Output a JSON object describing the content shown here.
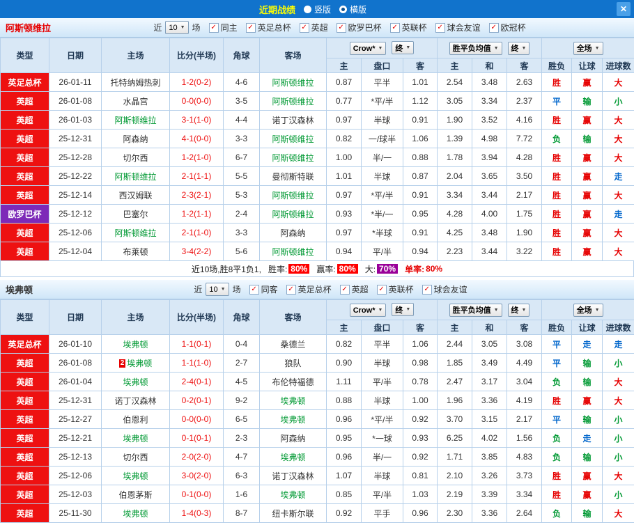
{
  "topbar": {
    "title": "近期战绩",
    "radios": [
      {
        "label": "竖版",
        "selected": false
      },
      {
        "label": "横版",
        "selected": true
      }
    ],
    "close_label": "✕"
  },
  "result_colors": {
    "red": "#e60000",
    "green": "#009933",
    "blue": "#0066cc"
  },
  "sections": [
    {
      "team": "阿斯顿维拉",
      "team_color": "#e60000",
      "filters": {
        "near": "近",
        "count": "10",
        "unit": "场",
        "checkboxes": [
          {
            "label": "同主",
            "checked": true
          },
          {
            "label": "英足总杯",
            "checked": true
          },
          {
            "label": "英超",
            "checked": true
          },
          {
            "label": "欧罗巴杯",
            "checked": true
          },
          {
            "label": "英联杯",
            "checked": true
          },
          {
            "label": "球会友谊",
            "checked": true
          },
          {
            "label": "欧冠杯",
            "checked": true
          }
        ]
      },
      "header": {
        "static_cols": [
          "类型",
          "日期",
          "主场",
          "比分(半场)",
          "角球",
          "客场"
        ],
        "odds_company": "Crow*",
        "odds_time": "终",
        "avg_label": "胜平负均值",
        "avg_time": "终",
        "scope": "全场",
        "sub_cols": [
          "主",
          "盘口",
          "客",
          "主",
          "和",
          "客",
          "胜负",
          "让球",
          "进球数"
        ]
      },
      "rows": [
        {
          "comp": "英足总杯",
          "comp_color": "#ee1111",
          "date": "26-01-11",
          "home": "托特纳姆热刺",
          "home_focus": false,
          "score": "1-2(0-2)",
          "corner": "4-6",
          "away": "阿斯顿维拉",
          "away_focus": true,
          "odds": [
            "0.87",
            "平半",
            "1.01"
          ],
          "avg": [
            "2.54",
            "3.48",
            "2.63"
          ],
          "results": [
            [
              "胜",
              "red"
            ],
            [
              "赢",
              "red"
            ],
            [
              "大",
              "red"
            ]
          ]
        },
        {
          "comp": "英超",
          "comp_color": "#ee1111",
          "date": "26-01-08",
          "home": "水晶宫",
          "home_focus": false,
          "score": "0-0(0-0)",
          "corner": "3-5",
          "away": "阿斯顿维拉",
          "away_focus": true,
          "odds": [
            "0.77",
            "*平/半",
            "1.12"
          ],
          "avg": [
            "3.05",
            "3.34",
            "2.37"
          ],
          "results": [
            [
              "平",
              "blue"
            ],
            [
              "输",
              "green"
            ],
            [
              "小",
              "green"
            ]
          ]
        },
        {
          "comp": "英超",
          "comp_color": "#ee1111",
          "date": "26-01-03",
          "home": "阿斯顿维拉",
          "home_focus": true,
          "score": "3-1(1-0)",
          "corner": "4-4",
          "away": "诺丁汉森林",
          "away_focus": false,
          "odds": [
            "0.97",
            "半球",
            "0.91"
          ],
          "avg": [
            "1.90",
            "3.52",
            "4.16"
          ],
          "results": [
            [
              "胜",
              "red"
            ],
            [
              "赢",
              "red"
            ],
            [
              "大",
              "red"
            ]
          ]
        },
        {
          "comp": "英超",
          "comp_color": "#ee1111",
          "date": "25-12-31",
          "home": "阿森纳",
          "home_focus": false,
          "score": "4-1(0-0)",
          "corner": "3-3",
          "away": "阿斯顿维拉",
          "away_focus": true,
          "odds": [
            "0.82",
            "一/球半",
            "1.06"
          ],
          "avg": [
            "1.39",
            "4.98",
            "7.72"
          ],
          "results": [
            [
              "负",
              "green"
            ],
            [
              "输",
              "green"
            ],
            [
              "大",
              "red"
            ]
          ]
        },
        {
          "comp": "英超",
          "comp_color": "#ee1111",
          "date": "25-12-28",
          "home": "切尔西",
          "home_focus": false,
          "score": "1-2(1-0)",
          "corner": "6-7",
          "away": "阿斯顿维拉",
          "away_focus": true,
          "odds": [
            "1.00",
            "半/一",
            "0.88"
          ],
          "avg": [
            "1.78",
            "3.94",
            "4.28"
          ],
          "results": [
            [
              "胜",
              "red"
            ],
            [
              "赢",
              "red"
            ],
            [
              "大",
              "red"
            ]
          ]
        },
        {
          "comp": "英超",
          "comp_color": "#ee1111",
          "date": "25-12-22",
          "home": "阿斯顿维拉",
          "home_focus": true,
          "score": "2-1(1-1)",
          "corner": "5-5",
          "away": "曼彻斯特联",
          "away_focus": false,
          "odds": [
            "1.01",
            "半球",
            "0.87"
          ],
          "avg": [
            "2.04",
            "3.65",
            "3.50"
          ],
          "results": [
            [
              "胜",
              "red"
            ],
            [
              "赢",
              "red"
            ],
            [
              "走",
              "blue"
            ]
          ]
        },
        {
          "comp": "英超",
          "comp_color": "#ee1111",
          "date": "25-12-14",
          "home": "西汉姆联",
          "home_focus": false,
          "score": "2-3(2-1)",
          "corner": "5-3",
          "away": "阿斯顿维拉",
          "away_focus": true,
          "odds": [
            "0.97",
            "*平/半",
            "0.91"
          ],
          "avg": [
            "3.34",
            "3.44",
            "2.17"
          ],
          "results": [
            [
              "胜",
              "red"
            ],
            [
              "赢",
              "red"
            ],
            [
              "大",
              "red"
            ]
          ]
        },
        {
          "comp": "欧罗巴杯",
          "comp_color": "#7d2ab8",
          "date": "25-12-12",
          "home": "巴塞尔",
          "home_focus": false,
          "score": "1-2(1-1)",
          "corner": "2-4",
          "away": "阿斯顿维拉",
          "away_focus": true,
          "odds": [
            "0.93",
            "*半/一",
            "0.95"
          ],
          "avg": [
            "4.28",
            "4.00",
            "1.75"
          ],
          "results": [
            [
              "胜",
              "red"
            ],
            [
              "赢",
              "red"
            ],
            [
              "走",
              "blue"
            ]
          ]
        },
        {
          "comp": "英超",
          "comp_color": "#ee1111",
          "date": "25-12-06",
          "home": "阿斯顿维拉",
          "home_focus": true,
          "score": "2-1(1-0)",
          "corner": "3-3",
          "away": "阿森纳",
          "away_focus": false,
          "odds": [
            "0.97",
            "*半球",
            "0.91"
          ],
          "avg": [
            "4.25",
            "3.48",
            "1.90"
          ],
          "results": [
            [
              "胜",
              "red"
            ],
            [
              "赢",
              "red"
            ],
            [
              "大",
              "red"
            ]
          ]
        },
        {
          "comp": "英超",
          "comp_color": "#ee1111",
          "date": "25-12-04",
          "home": "布莱顿",
          "home_focus": false,
          "score": "3-4(2-2)",
          "corner": "5-6",
          "away": "阿斯顿维拉",
          "away_focus": true,
          "odds": [
            "0.94",
            "平/半",
            "0.94"
          ],
          "avg": [
            "2.23",
            "3.44",
            "3.22"
          ],
          "results": [
            [
              "胜",
              "red"
            ],
            [
              "赢",
              "red"
            ],
            [
              "大",
              "red"
            ]
          ]
        }
      ],
      "summary": {
        "prefix": "近10场,胜8平1负1,",
        "items": [
          {
            "label": "胜率:",
            "value": "80%",
            "badge_bg": "#ff0000"
          },
          {
            "label": "赢率:",
            "value": "80%",
            "badge_bg": "#ff0000"
          },
          {
            "label": "大:",
            "value": "70%",
            "badge_bg": "#990099"
          },
          {
            "label": "单率:",
            "value": "80%",
            "badge_bg": null
          }
        ]
      }
    },
    {
      "team": "埃弗顿",
      "team_color": "#333333",
      "filters": {
        "near": "近",
        "count": "10",
        "unit": "场",
        "checkboxes": [
          {
            "label": "同客",
            "checked": true
          },
          {
            "label": "英足总杯",
            "checked": true
          },
          {
            "label": "英超",
            "checked": true
          },
          {
            "label": "英联杯",
            "checked": true
          },
          {
            "label": "球会友谊",
            "checked": true
          }
        ]
      },
      "header": {
        "static_cols": [
          "类型",
          "日期",
          "主场",
          "比分(半场)",
          "角球",
          "客场"
        ],
        "odds_company": "Crow*",
        "odds_time": "终",
        "avg_label": "胜平负均值",
        "avg_time": "终",
        "scope": "全场",
        "sub_cols": [
          "主",
          "盘口",
          "客",
          "主",
          "和",
          "客",
          "胜负",
          "让球",
          "进球数"
        ]
      },
      "rows": [
        {
          "comp": "英足总杯",
          "comp_color": "#ee1111",
          "date": "26-01-10",
          "home": "埃弗顿",
          "home_focus": true,
          "score": "1-1(0-1)",
          "corner": "0-4",
          "away": "桑德兰",
          "away_focus": false,
          "odds": [
            "0.82",
            "平半",
            "1.06"
          ],
          "avg": [
            "2.44",
            "3.05",
            "3.08"
          ],
          "results": [
            [
              "平",
              "blue"
            ],
            [
              "走",
              "blue"
            ],
            [
              "走",
              "blue"
            ]
          ]
        },
        {
          "comp": "英超",
          "comp_color": "#ee1111",
          "date": "26-01-08",
          "home": "埃弗顿",
          "home_focus": true,
          "home_badge": "2",
          "score": "1-1(1-0)",
          "corner": "2-7",
          "away": "狼队",
          "away_focus": false,
          "odds": [
            "0.90",
            "半球",
            "0.98"
          ],
          "avg": [
            "1.85",
            "3.49",
            "4.49"
          ],
          "results": [
            [
              "平",
              "blue"
            ],
            [
              "输",
              "green"
            ],
            [
              "小",
              "green"
            ]
          ]
        },
        {
          "comp": "英超",
          "comp_color": "#ee1111",
          "date": "26-01-04",
          "home": "埃弗顿",
          "home_focus": true,
          "score": "2-4(0-1)",
          "corner": "4-5",
          "away": "布伦特福德",
          "away_focus": false,
          "odds": [
            "1.11",
            "平/半",
            "0.78"
          ],
          "avg": [
            "2.47",
            "3.17",
            "3.04"
          ],
          "results": [
            [
              "负",
              "green"
            ],
            [
              "输",
              "green"
            ],
            [
              "大",
              "red"
            ]
          ]
        },
        {
          "comp": "英超",
          "comp_color": "#ee1111",
          "date": "25-12-31",
          "home": "诺丁汉森林",
          "home_focus": false,
          "score": "0-2(0-1)",
          "corner": "9-2",
          "away": "埃弗顿",
          "away_focus": true,
          "odds": [
            "0.88",
            "半球",
            "1.00"
          ],
          "avg": [
            "1.96",
            "3.36",
            "4.19"
          ],
          "results": [
            [
              "胜",
              "red"
            ],
            [
              "赢",
              "red"
            ],
            [
              "大",
              "red"
            ]
          ]
        },
        {
          "comp": "英超",
          "comp_color": "#ee1111",
          "date": "25-12-27",
          "home": "伯恩利",
          "home_focus": false,
          "score": "0-0(0-0)",
          "corner": "6-5",
          "away": "埃弗顿",
          "away_focus": true,
          "odds": [
            "0.96",
            "*平/半",
            "0.92"
          ],
          "avg": [
            "3.70",
            "3.15",
            "2.17"
          ],
          "results": [
            [
              "平",
              "blue"
            ],
            [
              "输",
              "green"
            ],
            [
              "小",
              "green"
            ]
          ]
        },
        {
          "comp": "英超",
          "comp_color": "#ee1111",
          "date": "25-12-21",
          "home": "埃弗顿",
          "home_focus": true,
          "score": "0-1(0-1)",
          "corner": "2-3",
          "away": "阿森纳",
          "away_focus": false,
          "odds": [
            "0.95",
            "*一球",
            "0.93"
          ],
          "avg": [
            "6.25",
            "4.02",
            "1.56"
          ],
          "results": [
            [
              "负",
              "green"
            ],
            [
              "走",
              "blue"
            ],
            [
              "小",
              "green"
            ]
          ]
        },
        {
          "comp": "英超",
          "comp_color": "#ee1111",
          "date": "25-12-13",
          "home": "切尔西",
          "home_focus": false,
          "score": "2-0(2-0)",
          "corner": "4-7",
          "away": "埃弗顿",
          "away_focus": true,
          "odds": [
            "0.96",
            "半/一",
            "0.92"
          ],
          "avg": [
            "1.71",
            "3.85",
            "4.83"
          ],
          "results": [
            [
              "负",
              "green"
            ],
            [
              "输",
              "green"
            ],
            [
              "小",
              "green"
            ]
          ]
        },
        {
          "comp": "英超",
          "comp_color": "#ee1111",
          "date": "25-12-06",
          "home": "埃弗顿",
          "home_focus": true,
          "score": "3-0(2-0)",
          "corner": "6-3",
          "away": "诺丁汉森林",
          "away_focus": false,
          "odds": [
            "1.07",
            "半球",
            "0.81"
          ],
          "avg": [
            "2.10",
            "3.26",
            "3.73"
          ],
          "results": [
            [
              "胜",
              "red"
            ],
            [
              "赢",
              "red"
            ],
            [
              "大",
              "red"
            ]
          ]
        },
        {
          "comp": "英超",
          "comp_color": "#ee1111",
          "date": "25-12-03",
          "home": "伯恩茅斯",
          "home_focus": false,
          "score": "0-1(0-0)",
          "corner": "1-6",
          "away": "埃弗顿",
          "away_focus": true,
          "odds": [
            "0.85",
            "平/半",
            "1.03"
          ],
          "avg": [
            "2.19",
            "3.39",
            "3.34"
          ],
          "results": [
            [
              "胜",
              "red"
            ],
            [
              "赢",
              "red"
            ],
            [
              "小",
              "green"
            ]
          ]
        },
        {
          "comp": "英超",
          "comp_color": "#ee1111",
          "date": "25-11-30",
          "home": "埃弗顿",
          "home_focus": true,
          "score": "1-4(0-3)",
          "corner": "8-7",
          "away": "纽卡斯尔联",
          "away_focus": false,
          "odds": [
            "0.92",
            "平手",
            "0.96"
          ],
          "avg": [
            "2.30",
            "3.36",
            "2.64"
          ],
          "results": [
            [
              "负",
              "green"
            ],
            [
              "输",
              "green"
            ],
            [
              "大",
              "red"
            ]
          ]
        }
      ]
    }
  ]
}
